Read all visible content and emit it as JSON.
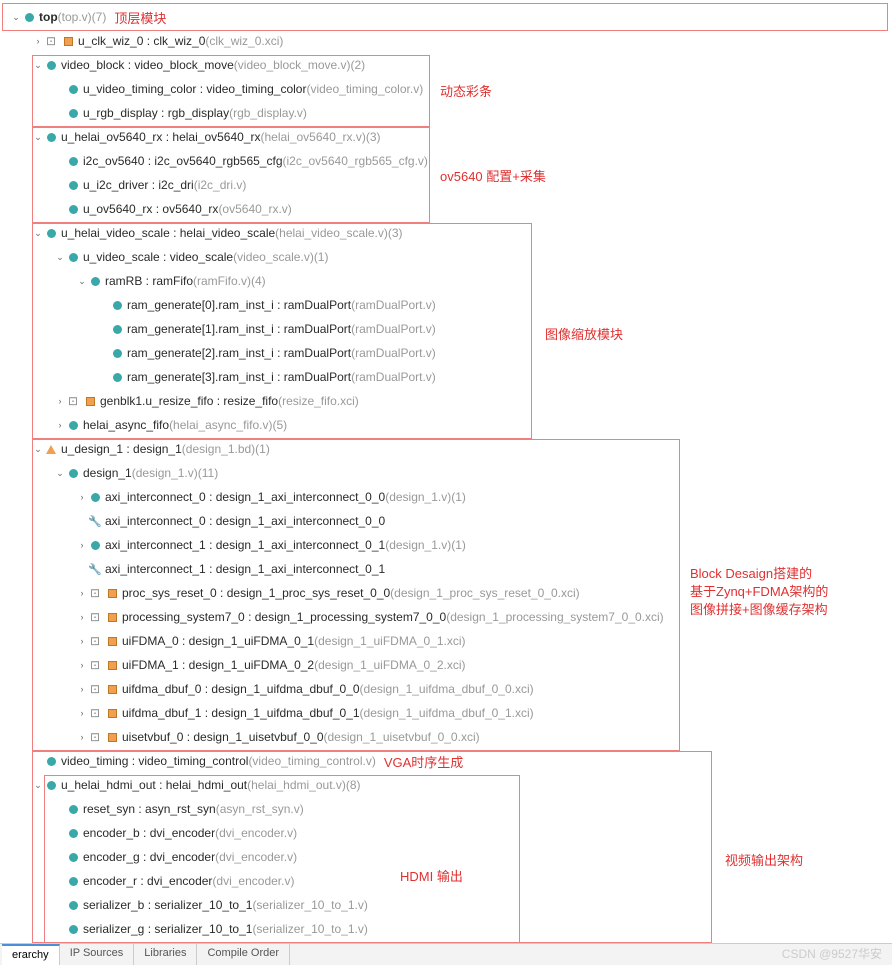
{
  "annotations": {
    "top": "顶层模块",
    "side1": "动态彩条",
    "side2": "ov5640 配置+采集",
    "side3": "图像缩放模块",
    "side4_l1": "Block Desaign搭建的",
    "side4_l2": "基于Zynq+FDMA架构的",
    "side4_l3": "图像拼接+图像缓存架构",
    "vga": "VGA时序生成",
    "hdmi": "HDMI 输出",
    "side5": "视频输出架构"
  },
  "tabs": [
    "erarchy",
    "IP Sources",
    "Libraries",
    "Compile Order"
  ],
  "watermark": "CSDN @9527华安",
  "tree": [
    {
      "d": 0,
      "a": "v",
      "i": "dt",
      "n": "top",
      "f": "(top.v)",
      "c": "(7)",
      "bold": true,
      "ann": "top"
    },
    {
      "d": 1,
      "a": ">",
      "i": "sq",
      "pre": "⊡",
      "n": "u_clk_wiz_0 : clk_wiz_0",
      "f": "(clk_wiz_0.xci)"
    },
    {
      "d": 1,
      "a": "v",
      "i": "dt",
      "n": "video_block : video_block_move",
      "f": "(video_block_move.v)",
      "c": "(2)"
    },
    {
      "d": 2,
      "a": "",
      "i": "dt",
      "n": "u_video_timing_color : video_timing_color",
      "f": "(video_timing_color.v)"
    },
    {
      "d": 2,
      "a": "",
      "i": "dt",
      "n": "u_rgb_display : rgb_display",
      "f": "(rgb_display.v)"
    },
    {
      "d": 1,
      "a": "v",
      "i": "dt",
      "n": "u_helai_ov5640_rx : helai_ov5640_rx",
      "f": "(helai_ov5640_rx.v)",
      "c": "(3)"
    },
    {
      "d": 2,
      "a": "",
      "i": "dt",
      "n": "i2c_ov5640 : i2c_ov5640_rgb565_cfg",
      "f": "(i2c_ov5640_rgb565_cfg.v)"
    },
    {
      "d": 2,
      "a": "",
      "i": "dt",
      "n": "u_i2c_driver : i2c_dri",
      "f": "(i2c_dri.v)"
    },
    {
      "d": 2,
      "a": "",
      "i": "dt",
      "n": "u_ov5640_rx : ov5640_rx",
      "f": "(ov5640_rx.v)"
    },
    {
      "d": 1,
      "a": "v",
      "i": "dt",
      "n": "u_helai_video_scale : helai_video_scale",
      "f": "(helai_video_scale.v)",
      "c": "(3)"
    },
    {
      "d": 2,
      "a": "v",
      "i": "dt",
      "n": "u_video_scale : video_scale",
      "f": "(video_scale.v)",
      "c": "(1)"
    },
    {
      "d": 3,
      "a": "v",
      "i": "dt",
      "n": "ramRB : ramFifo",
      "f": "(ramFifo.v)",
      "c": "(4)"
    },
    {
      "d": 4,
      "a": "",
      "i": "dt",
      "n": "ram_generate[0].ram_inst_i : ramDualPort",
      "f": "(ramDualPort.v)"
    },
    {
      "d": 4,
      "a": "",
      "i": "dt",
      "n": "ram_generate[1].ram_inst_i : ramDualPort",
      "f": "(ramDualPort.v)"
    },
    {
      "d": 4,
      "a": "",
      "i": "dt",
      "n": "ram_generate[2].ram_inst_i : ramDualPort",
      "f": "(ramDualPort.v)"
    },
    {
      "d": 4,
      "a": "",
      "i": "dt",
      "n": "ram_generate[3].ram_inst_i : ramDualPort",
      "f": "(ramDualPort.v)"
    },
    {
      "d": 2,
      "a": ">",
      "i": "sq",
      "pre": "⊡",
      "n": "genblk1.u_resize_fifo : resize_fifo",
      "f": "(resize_fifo.xci)"
    },
    {
      "d": 2,
      "a": ">",
      "i": "dt",
      "n": "helai_async_fifo",
      "f": "(helai_async_fifo.v)",
      "c": "(5)"
    },
    {
      "d": 1,
      "a": "v",
      "i": "tr",
      "n": "u_design_1 : design_1",
      "f": "(design_1.bd)",
      "c": "(1)"
    },
    {
      "d": 2,
      "a": "v",
      "i": "dt",
      "n": "design_1",
      "f": "(design_1.v)",
      "c": "(11)"
    },
    {
      "d": 3,
      "a": ">",
      "i": "dt",
      "n": "axi_interconnect_0 : design_1_axi_interconnect_0_0",
      "f": "(design_1.v)",
      "c": "(1)"
    },
    {
      "d": 3,
      "a": "",
      "i": "wr",
      "n": "axi_interconnect_0 : design_1_axi_interconnect_0_0"
    },
    {
      "d": 3,
      "a": ">",
      "i": "dt",
      "n": "axi_interconnect_1 : design_1_axi_interconnect_0_1",
      "f": "(design_1.v)",
      "c": "(1)"
    },
    {
      "d": 3,
      "a": "",
      "i": "wr",
      "n": "axi_interconnect_1 : design_1_axi_interconnect_0_1"
    },
    {
      "d": 3,
      "a": ">",
      "i": "sq",
      "pre": "⊡",
      "n": "proc_sys_reset_0 : design_1_proc_sys_reset_0_0",
      "f": "(design_1_proc_sys_reset_0_0.xci)"
    },
    {
      "d": 3,
      "a": ">",
      "i": "sq",
      "pre": "⊡",
      "n": "processing_system7_0 : design_1_processing_system7_0_0",
      "f": "(design_1_processing_system7_0_0.xci)"
    },
    {
      "d": 3,
      "a": ">",
      "i": "sq",
      "pre": "⊡",
      "n": "uiFDMA_0 : design_1_uiFDMA_0_1",
      "f": "(design_1_uiFDMA_0_1.xci)"
    },
    {
      "d": 3,
      "a": ">",
      "i": "sq",
      "pre": "⊡",
      "n": "uiFDMA_1 : design_1_uiFDMA_0_2",
      "f": "(design_1_uiFDMA_0_2.xci)"
    },
    {
      "d": 3,
      "a": ">",
      "i": "sq",
      "pre": "⊡",
      "n": "uifdma_dbuf_0 : design_1_uifdma_dbuf_0_0",
      "f": "(design_1_uifdma_dbuf_0_0.xci)"
    },
    {
      "d": 3,
      "a": ">",
      "i": "sq",
      "pre": "⊡",
      "n": "uifdma_dbuf_1 : design_1_uifdma_dbuf_0_1",
      "f": "(design_1_uifdma_dbuf_0_1.xci)"
    },
    {
      "d": 3,
      "a": ">",
      "i": "sq",
      "pre": "⊡",
      "n": "uisetvbuf_0 : design_1_uisetvbuf_0_0",
      "f": "(design_1_uisetvbuf_0_0.xci)"
    },
    {
      "d": 1,
      "a": "",
      "i": "dt",
      "n": "video_timing : video_timing_control",
      "f": "(video_timing_control.v)",
      "ann": "vga"
    },
    {
      "d": 1,
      "a": "v",
      "i": "dt",
      "n": "u_helai_hdmi_out : helai_hdmi_out",
      "f": "(helai_hdmi_out.v)",
      "c": "(8)"
    },
    {
      "d": 2,
      "a": "",
      "i": "dt",
      "n": "reset_syn : asyn_rst_syn",
      "f": "(asyn_rst_syn.v)"
    },
    {
      "d": 2,
      "a": "",
      "i": "dt",
      "n": "encoder_b : dvi_encoder",
      "f": "(dvi_encoder.v)"
    },
    {
      "d": 2,
      "a": "",
      "i": "dt",
      "n": "encoder_g : dvi_encoder",
      "f": "(dvi_encoder.v)"
    },
    {
      "d": 2,
      "a": "",
      "i": "dt",
      "n": "encoder_r : dvi_encoder",
      "f": "(dvi_encoder.v)"
    },
    {
      "d": 2,
      "a": "",
      "i": "dt",
      "n": "serializer_b : serializer_10_to_1",
      "f": "(serializer_10_to_1.v)"
    },
    {
      "d": 2,
      "a": "",
      "i": "dt",
      "n": "serializer_g : serializer_10_to_1",
      "f": "(serializer_10_to_1.v)"
    }
  ]
}
